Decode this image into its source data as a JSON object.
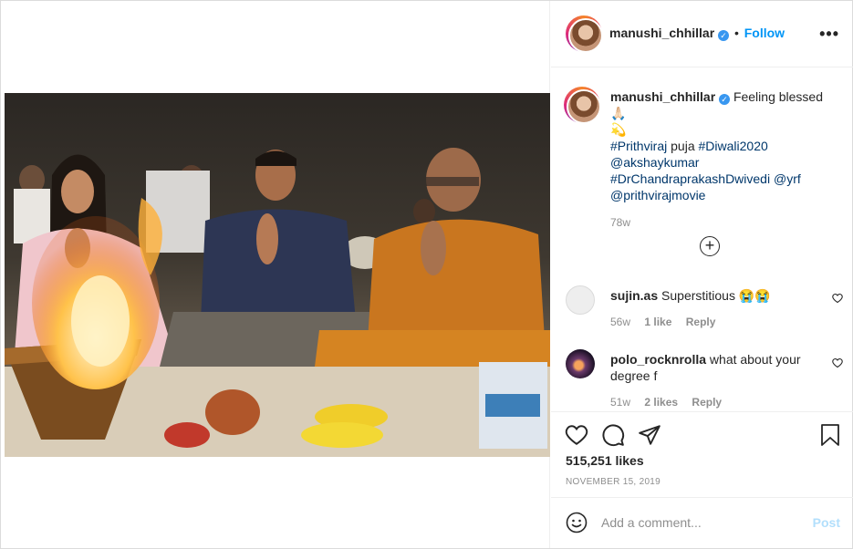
{
  "header": {
    "username": "manushi_chhillar",
    "verified_mark": "✓",
    "separator": "•",
    "follow_label": "Follow",
    "more_icon": "more-horizontal-icon",
    "more_glyph": "•••"
  },
  "caption": {
    "username": "manushi_chhillar",
    "text": "Feeling blessed 🙏🏻",
    "line2": "💫",
    "hashtags_line1_a": "#Prithviraj",
    "line1_mid": " puja ",
    "hashtags_line1_b": "#Diwali2020",
    "mention1": "@akshaykumar",
    "hashtag2": "#DrChandraprakashDwivedi",
    "mention2": "@yrf",
    "mention3": "@prithvirajmovie",
    "time": "78w"
  },
  "load_more": {
    "icon": "plus-circle-icon",
    "glyph": "+"
  },
  "comments": [
    {
      "username": "sujin.as",
      "text": "Superstitious 😭😭",
      "time": "56w",
      "likes": "1 like",
      "reply": "Reply"
    },
    {
      "username": "polo_rocknrolla",
      "text": "what about your degree f",
      "time": "51w",
      "likes": "2 likes",
      "reply": "Reply"
    }
  ],
  "actions": {
    "like_icon": "heart-icon",
    "comment_icon": "comment-icon",
    "share_icon": "paper-plane-icon",
    "save_icon": "bookmark-icon"
  },
  "likes_count": "515,251 likes",
  "date": "NOVEMBER 15, 2019",
  "add_comment": {
    "emoji_icon": "smiley-icon",
    "placeholder": "Add a comment...",
    "post_label": "Post"
  },
  "colors": {
    "accent": "#0095f6",
    "verified": "#3897f0",
    "post_disabled": "#b2dffc",
    "muted": "#8e8e8e",
    "text": "#262626"
  }
}
